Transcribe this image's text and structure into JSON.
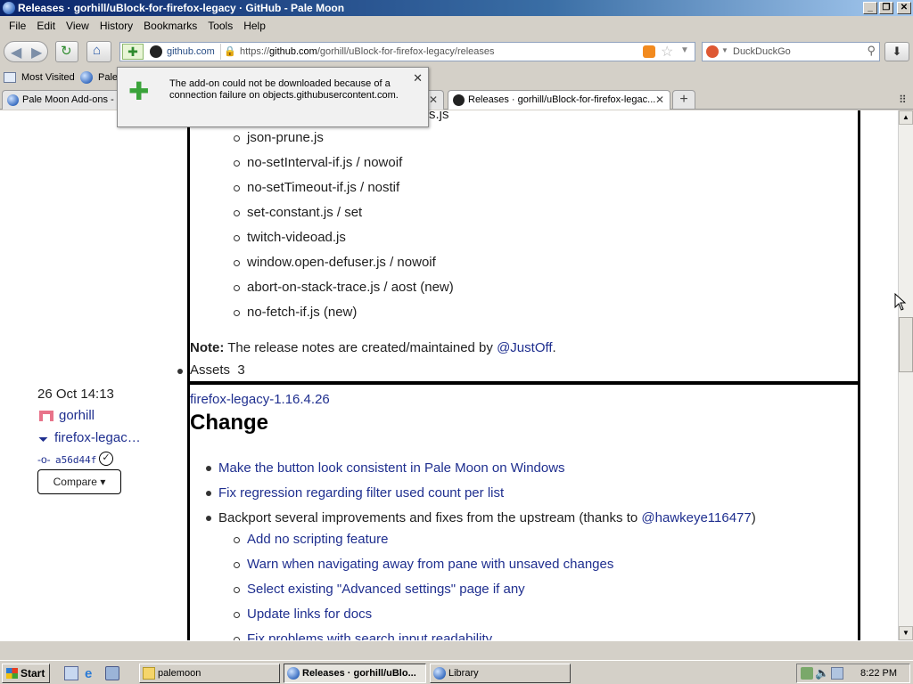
{
  "window": {
    "title": "Releases · gorhill/uBlock-for-firefox-legacy · GitHub - Pale Moon"
  },
  "menu": [
    "File",
    "Edit",
    "View",
    "History",
    "Bookmarks",
    "Tools",
    "Help"
  ],
  "address": {
    "site": "github.com",
    "url_prefix": "https://",
    "url_host": "github.com",
    "url_path": "/gorhill/uBlock-for-firefox-legacy/releases"
  },
  "search": {
    "placeholder": "DuckDuckGo"
  },
  "bookmarks": {
    "most_visited": "Most Visited",
    "pale": "Pale"
  },
  "tabs": [
    {
      "label": "Pale Moon Add-ons - E"
    },
    {
      "label": "Releases · gorhill/uBlock-for-firefox-legac..."
    }
  ],
  "popup": {
    "message": "The add-on could not be downloaded because of a connection failure on objects.githubusercontent.com."
  },
  "release_prev": {
    "partial_item": "s.js",
    "items": [
      "json-prune.js",
      "no-setInterval-if.js / nowoif",
      "no-setTimeout-if.js / nostif",
      "set-constant.js / set",
      "twitch-videoad.js",
      "window.open-defuser.js / nowoif",
      "abort-on-stack-trace.js / aost (new)",
      "no-fetch-if.js (new)"
    ],
    "note_label": "Note:",
    "note_text": " The release notes are created/maintained by ",
    "note_link": "@JustOff",
    "note_end": ".",
    "assets_label": "Assets",
    "assets_count": "3"
  },
  "release_meta": {
    "date": "26 Oct 14:13",
    "author": "gorhill",
    "tag": "firefox-legac…",
    "commit": "a56d44f",
    "compare": "Compare"
  },
  "release": {
    "tag_link": "firefox-legacy-1.16.4.26",
    "heading": "Change",
    "items": [
      {
        "text": "Make the button look consistent in Pale Moon on Windows"
      },
      {
        "text": "Fix regression regarding filter used count per list"
      },
      {
        "text": "Backport several improvements and fixes from the upstream (thanks to ",
        "link": "@hawkeye116477",
        "end": ")"
      }
    ],
    "subitems": [
      "Add no scripting feature",
      "Warn when navigating away from pane with unsaved changes",
      "Select existing \"Advanced settings\" page if any",
      "Update links for docs",
      "Fix problems with search input readability"
    ]
  },
  "taskbar": {
    "start": "Start",
    "tasks": [
      "palemoon",
      "Releases · gorhill/uBlo...",
      "Library"
    ],
    "clock": "8:22 PM"
  },
  "colors": {
    "link": "#1f2f8f",
    "titlebar": "#0a246a"
  }
}
